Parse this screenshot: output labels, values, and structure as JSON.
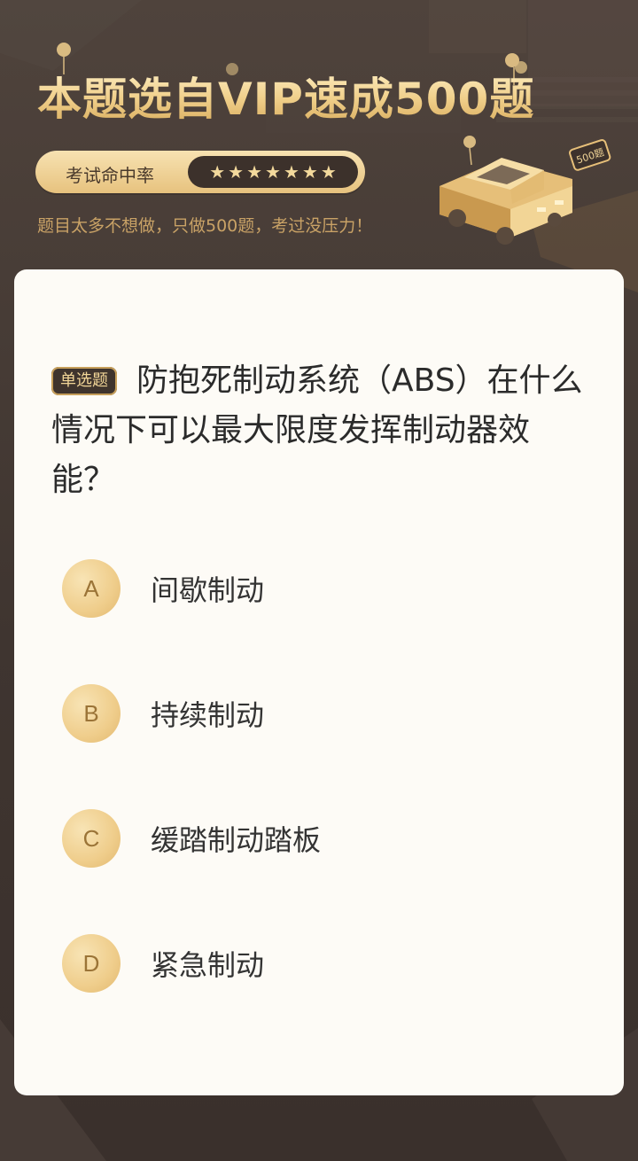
{
  "banner": {
    "title": "本题选自VIP速成500题",
    "rate_label": "考试命中率",
    "stars": [
      "★",
      "★",
      "★",
      "★",
      "★",
      "★",
      "★"
    ],
    "subtitle": "题目太多不想做，只做500题，考过没压力！",
    "car_tag": "500题"
  },
  "question": {
    "type_badge": "单选题",
    "text": "防抱死制动系统（ABS）在什么情况下可以最大限度发挥制动器效能？",
    "options": [
      {
        "letter": "A",
        "text": "间歇制动"
      },
      {
        "letter": "B",
        "text": "持续制动"
      },
      {
        "letter": "C",
        "text": "缓踏制动踏板"
      },
      {
        "letter": "D",
        "text": "紧急制动"
      }
    ]
  },
  "colors": {
    "background": "#4a3f39",
    "gold": "#efcd8b",
    "card": "#fdfbf6",
    "badge_bg": "#3f342d"
  }
}
